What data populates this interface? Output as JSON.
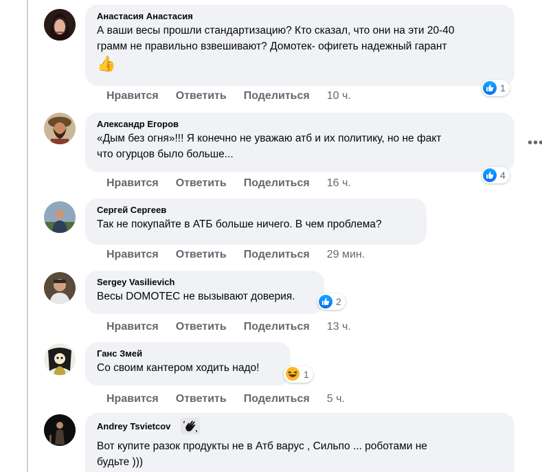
{
  "common": {
    "like": "Нравится",
    "reply": "Ответить",
    "share": "Поделиться"
  },
  "comments": [
    {
      "author": "Анастасия Анастасия",
      "lines": [
        "А ваши весы прошли стандартизацию? Кто сказал, что они на эти 20-40",
        "грамм не правильно взвешивают? Домотек- офигеть надежный гарант",
        "👍"
      ],
      "time": "10 ч.",
      "reactions": "1"
    },
    {
      "author": "Александр Егоров",
      "lines": [
        "«Дым без огня»!!! Я конечно не уважаю атб и их политику, но не факт",
        "что огурцов было больше..."
      ],
      "time": "16 ч.",
      "reactions": "4"
    },
    {
      "author": "Сергей Сергеев",
      "lines": [
        "Так не покупайте в АТБ больше ничего. В чем проблема?"
      ],
      "time": "29 мин.",
      "reactions": ""
    },
    {
      "author": "Sergey Vasilievich",
      "lines": [
        "Весы DOMOTEC не вызывают доверия."
      ],
      "time": "13 ч.",
      "reactions": "2"
    },
    {
      "author": "Ганс Змей",
      "lines": [
        "Со своим кантером ходить надо!"
      ],
      "time": "5 ч.",
      "reactions": "1"
    },
    {
      "author": "Andrey Tsvietcov",
      "lines": [
        "Вот купите разок продукты не в Атб варус , Сильпо ... роботами не",
        "будьте )))"
      ],
      "time": "",
      "reactions": ""
    }
  ],
  "more_menu": "•••",
  "icons": [
    "thumbs-up-icon",
    "laughing-face-icon",
    "waving-hand-icon",
    "more-options-icon"
  ],
  "colors": {
    "like_blue": "#1877f2",
    "bubble": "#f0f2f5",
    "meta": "#65676b"
  }
}
